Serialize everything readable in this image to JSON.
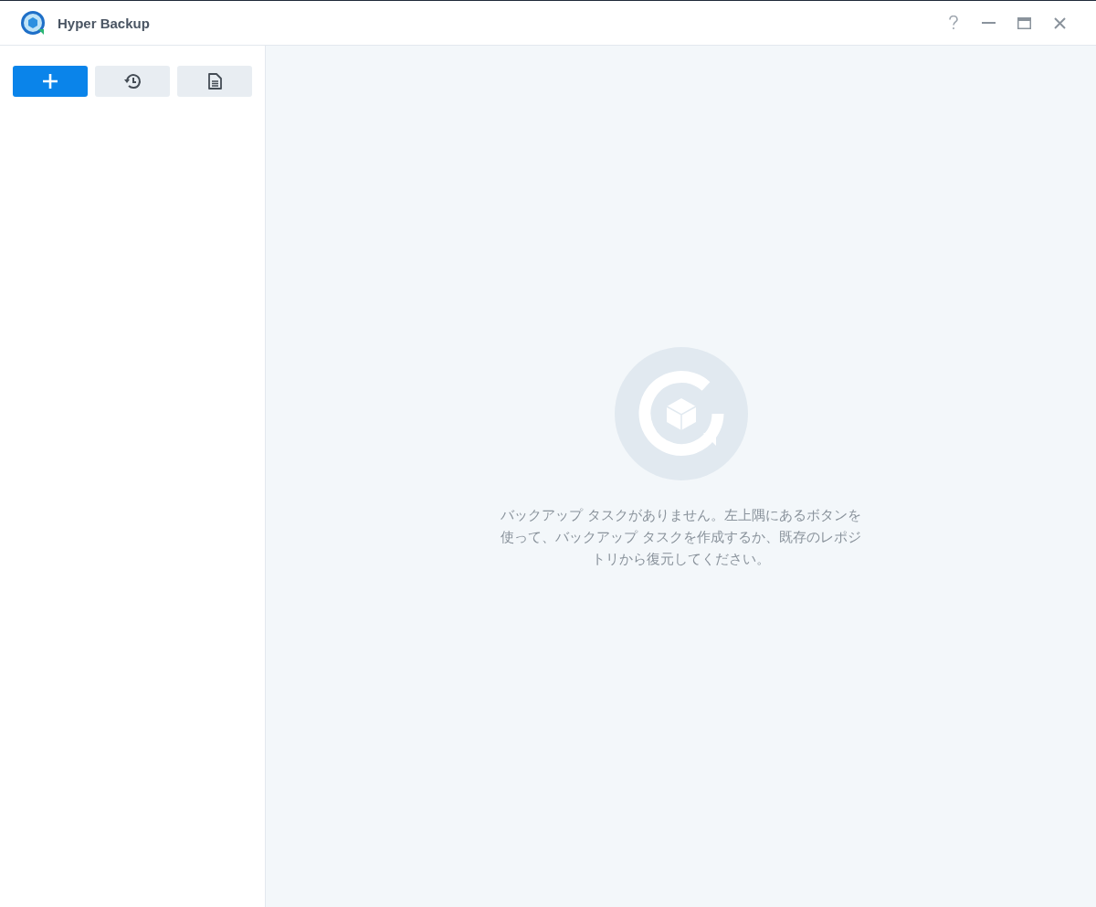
{
  "window": {
    "title": "Hyper Backup"
  },
  "empty_state": {
    "message": "バックアップ タスクがありません。左上隅にあるボタンを使って、バックアップ タスクを作成するか、既存のレポジトリから復元してください。"
  }
}
